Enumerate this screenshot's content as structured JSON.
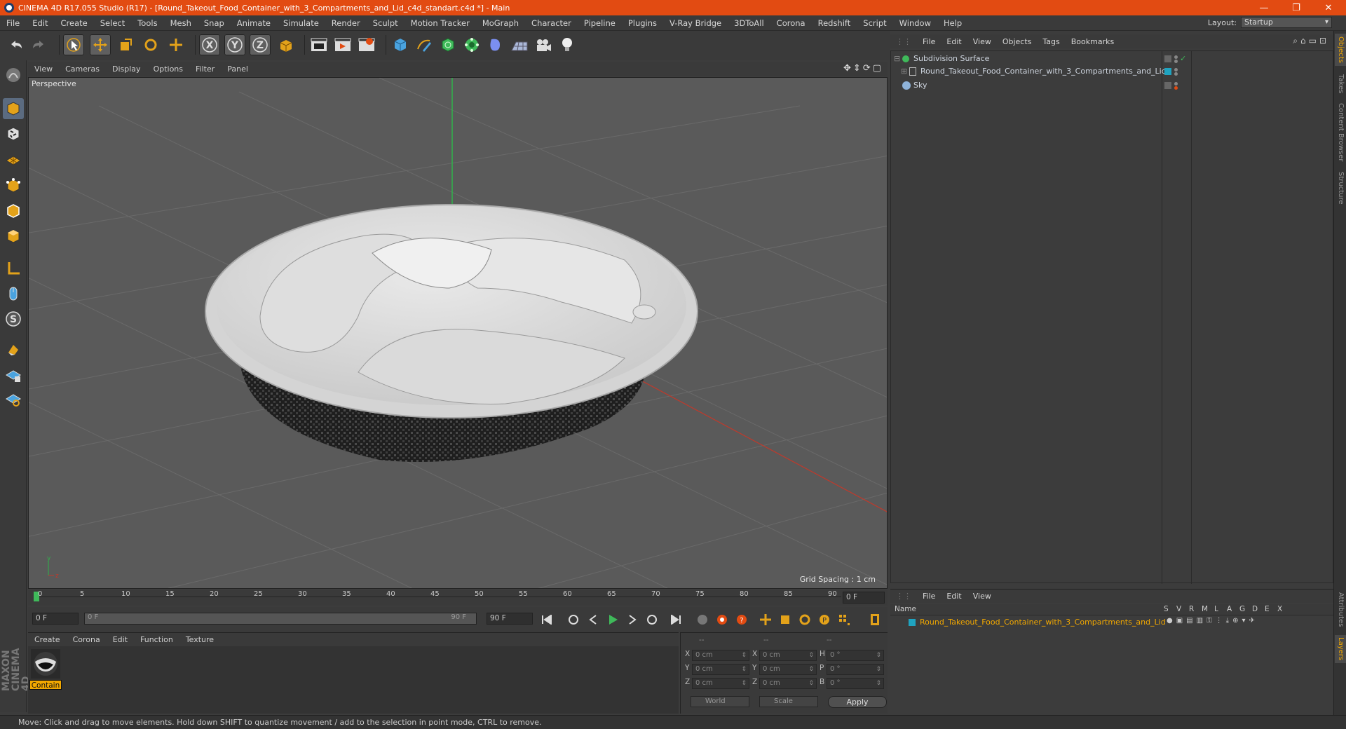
{
  "window": {
    "title": "CINEMA 4D R17.055 Studio (R17) - [Round_Takeout_Food_Container_with_3_Compartments_and_Lid_c4d_standart.c4d *] - Main"
  },
  "menu": [
    "File",
    "Edit",
    "Create",
    "Select",
    "Tools",
    "Mesh",
    "Snap",
    "Animate",
    "Simulate",
    "Render",
    "Sculpt",
    "Motion Tracker",
    "MoGraph",
    "Character",
    "Pipeline",
    "Plugins",
    "V-Ray Bridge",
    "3DToAll",
    "Corona",
    "Redshift",
    "Script",
    "Window",
    "Help"
  ],
  "layout": {
    "label": "Layout:",
    "value": "Startup"
  },
  "viewport": {
    "menu": [
      "View",
      "Cameras",
      "Display",
      "Options",
      "Filter",
      "Panel"
    ],
    "label": "Perspective",
    "grid_spacing": "Grid Spacing : 1 cm"
  },
  "timeline": {
    "ticks": [
      "0",
      "5",
      "10",
      "15",
      "20",
      "25",
      "30",
      "35",
      "40",
      "45",
      "50",
      "55",
      "60",
      "65",
      "70",
      "75",
      "80",
      "85",
      "90"
    ],
    "frame_end_field": "0 F",
    "current_frame": "0 F",
    "range_start": "0 F",
    "range_end": "90 F",
    "max_frame": "90 F"
  },
  "materials": {
    "menu": [
      "Create",
      "Corona",
      "Edit",
      "Function",
      "Texture"
    ],
    "items": [
      {
        "label": "Contain"
      }
    ]
  },
  "coordinates": {
    "headers": [
      "--",
      "--",
      "--"
    ],
    "rows": [
      {
        "a_label": "X",
        "a_val": "0 cm",
        "b_label": "X",
        "b_val": "0 cm",
        "c_label": "H",
        "c_val": "0 °"
      },
      {
        "a_label": "Y",
        "a_val": "0 cm",
        "b_label": "Y",
        "b_val": "0 cm",
        "c_label": "P",
        "c_val": "0 °"
      },
      {
        "a_label": "Z",
        "a_val": "0 cm",
        "b_label": "Z",
        "b_val": "0 cm",
        "c_label": "B",
        "c_val": "0 °"
      }
    ],
    "mode1": "World",
    "mode2": "Scale",
    "apply": "Apply"
  },
  "objects": {
    "menu": [
      "File",
      "Edit",
      "View",
      "Objects",
      "Tags",
      "Bookmarks"
    ],
    "items": [
      {
        "name": "Subdivision Surface"
      },
      {
        "name": "Round_Takeout_Food_Container_with_3_Compartments_and_Lid"
      },
      {
        "name": "Sky"
      }
    ]
  },
  "layers": {
    "menu": [
      "File",
      "Edit",
      "View"
    ],
    "columns": [
      "Name",
      "S",
      "V",
      "R",
      "M",
      "L",
      "A",
      "G",
      "D",
      "E",
      "X"
    ],
    "items": [
      {
        "name": "Round_Takeout_Food_Container_with_3_Compartments_and_Lid",
        "color": "#1fa3c0"
      }
    ]
  },
  "right_tabs": [
    "Objects",
    "Takes",
    "Content Browser",
    "Structure",
    "Attributes",
    "Layers"
  ],
  "status": "Move: Click and drag to move elements. Hold down SHIFT to quantize movement / add to the selection in point mode, CTRL to remove.",
  "colors": {
    "titlebar": "#e24b12",
    "accent": "#f2a800",
    "layer": "#1fa3c0"
  }
}
